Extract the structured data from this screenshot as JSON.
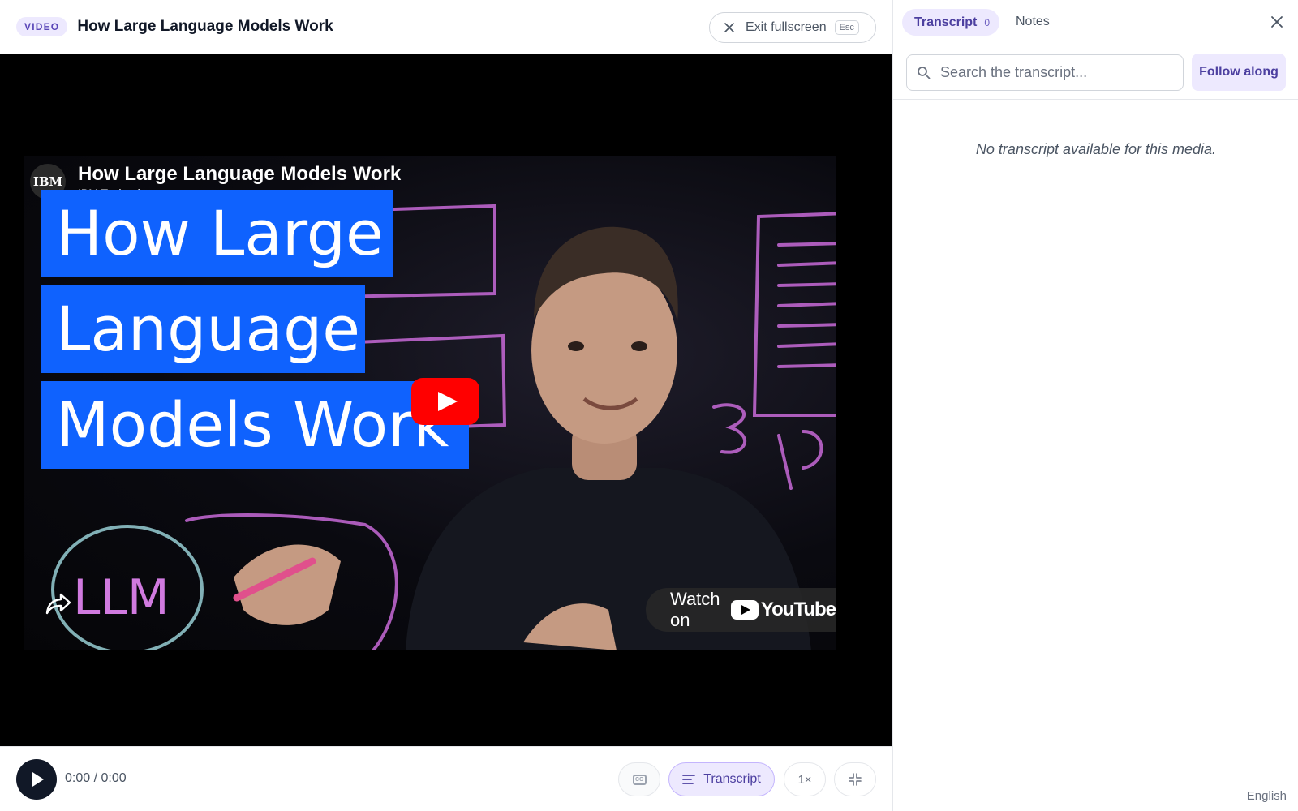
{
  "header": {
    "badge": "VIDEO",
    "title": "How Large Language Models Work",
    "exit_label": "Exit fullscreen",
    "exit_key": "Esc"
  },
  "video": {
    "channel_logo": "IBM",
    "title": "How Large Language Models Work",
    "channel": "IBM Technology",
    "banner_lines": [
      "How Large",
      "Language",
      "Models Work"
    ],
    "sketch_words": [
      "LLM"
    ],
    "watch_on": "Watch on",
    "youtube": "YouTube"
  },
  "controls": {
    "time": "0:00 / 0:00",
    "transcript_label": "Transcript",
    "speed": "1×"
  },
  "panel": {
    "tabs": [
      {
        "label": "Transcript",
        "count": "0"
      },
      {
        "label": "Notes"
      }
    ],
    "search_placeholder": "Search the transcript...",
    "follow_label": "Follow along",
    "empty_message": "No transcript available for this media.",
    "language": "English"
  },
  "colors": {
    "accent": "#ede9fe",
    "accent_text": "#4c3fa0",
    "banner": "#0f62fe",
    "youtube_red": "#ff0000"
  }
}
